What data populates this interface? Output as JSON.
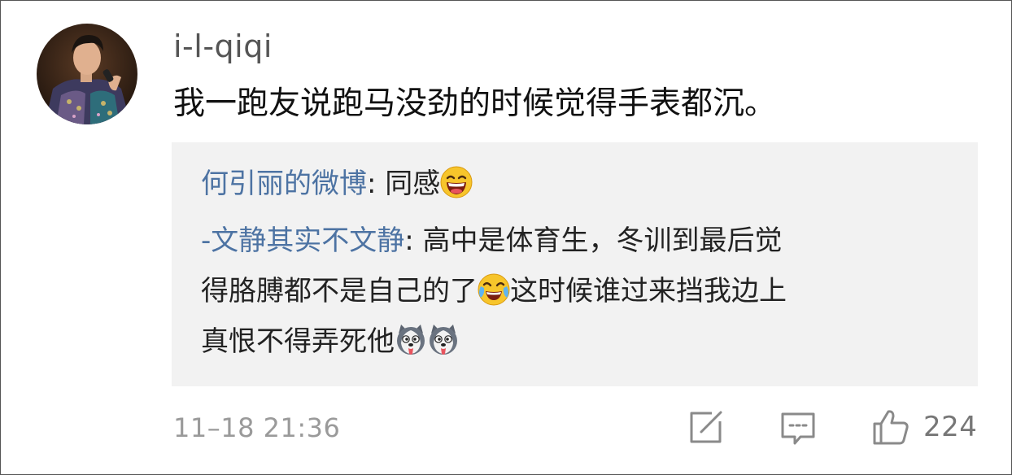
{
  "comment": {
    "username": "i-l-qiqi",
    "text": "我一跑友说跑马没劲的时候觉得手表都沉。",
    "timestamp": "11–18 21:36",
    "like_count": "224"
  },
  "replies": [
    {
      "author": "何引丽的微博",
      "separator": ": ",
      "text": "同感",
      "emojis": [
        "laughing-emoji"
      ]
    },
    {
      "author": "-文静其实不文静",
      "separator": ": ",
      "text_line1": "高中是体育生，冬训到最后觉",
      "text_line2a": "得胳膊都不是自己的了",
      "text_line2b": "这时候谁过来挡我边上",
      "text_line3": "真恨不得弄死他",
      "emojis": [
        "crying-laughing-emoji",
        "husky-dog-emoji",
        "husky-dog-emoji"
      ]
    }
  ],
  "colors": {
    "username": "#555555",
    "text": "#111111",
    "reply_author": "#4d73a3",
    "reply_background": "#f2f2f2",
    "meta": "#9a9a9a"
  },
  "icons": [
    "share-icon",
    "comment-icon",
    "like-icon"
  ]
}
